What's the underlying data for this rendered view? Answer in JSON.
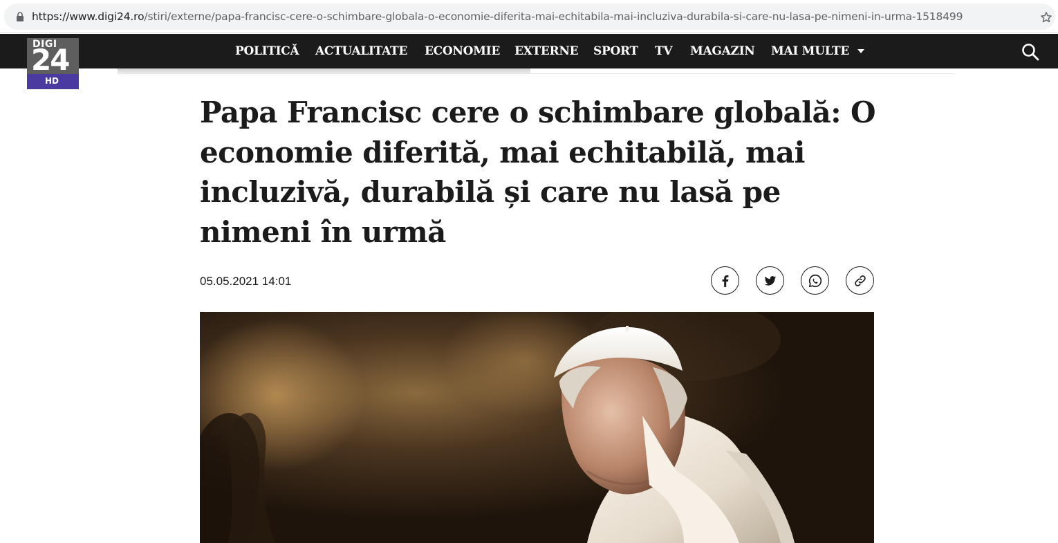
{
  "browser": {
    "url_host": "https://www.digi24.ro",
    "url_path": "/stiri/externe/papa-francisc-cere-o-schimbare-globala-o-economie-diferita-mai-echitabila-mai-incluziva-durabila-si-care-nu-lasa-pe-nimeni-in-urma-1518499",
    "icons": {
      "lock": "lock-icon",
      "bookmark": "star-icon"
    }
  },
  "logo": {
    "top": "DIGI",
    "number": "24",
    "badge": "HD"
  },
  "nav": {
    "items": [
      {
        "label": "POLITICĂ"
      },
      {
        "label": "ACTUALITATE"
      },
      {
        "label": "ECONOMIE"
      },
      {
        "label": "EXTERNE"
      },
      {
        "label": "SPORT"
      },
      {
        "label": "TV"
      },
      {
        "label": "MAGAZIN"
      },
      {
        "label": "MAI MULTE"
      }
    ],
    "icons": {
      "more": "caret-down-icon",
      "search": "search-icon"
    }
  },
  "article": {
    "headline": "Papa Francisc cere o schimbare globală: O economie diferită, mai echitabilă, mai incluzivă, durabilă și care nu lasă pe nimeni în urmă",
    "date": "05.05.2021 14:01",
    "share": [
      {
        "icon": "facebook-icon"
      },
      {
        "icon": "twitter-icon"
      },
      {
        "icon": "whatsapp-icon"
      },
      {
        "icon": "link-icon"
      }
    ]
  },
  "colors": {
    "nav_bg": "#1b1b1b",
    "logo_purple": "#4b3aa0",
    "text": "#1b1b1b"
  }
}
